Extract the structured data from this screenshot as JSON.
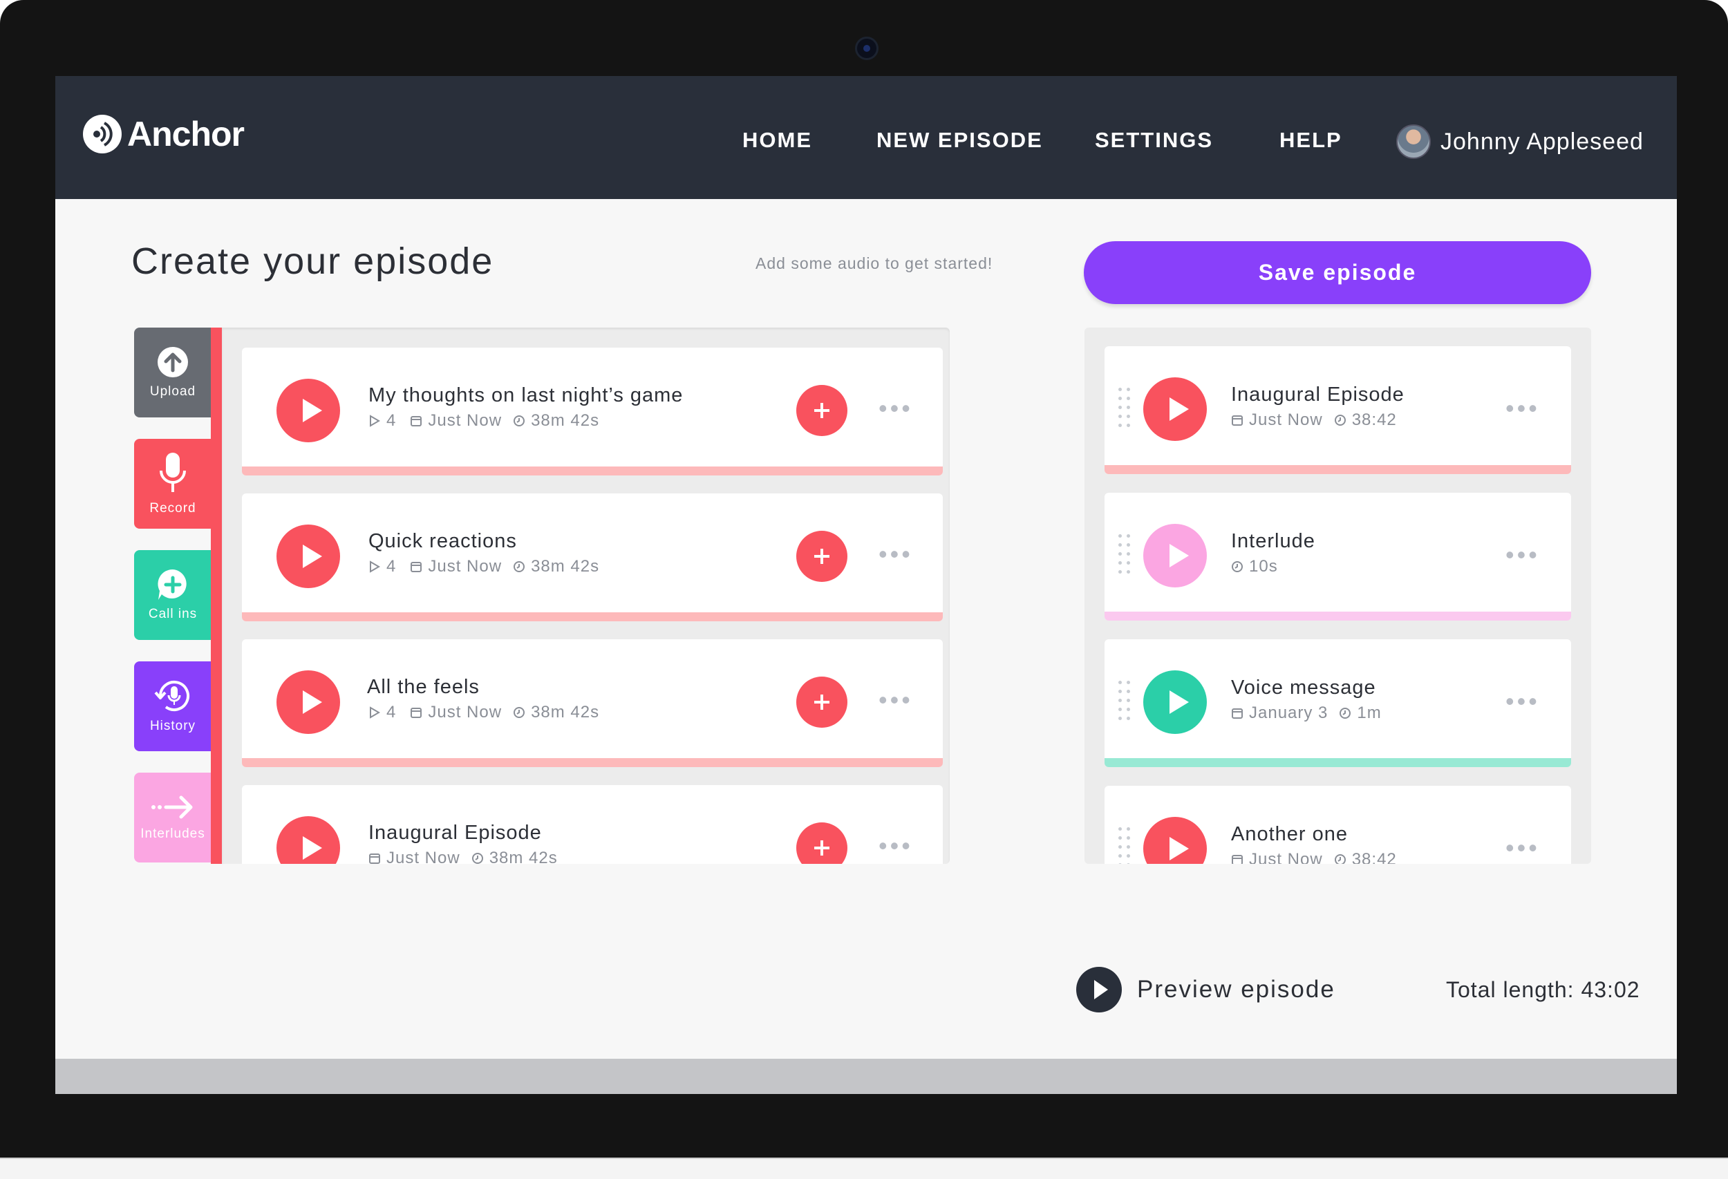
{
  "app": {
    "name": "Anchor"
  },
  "nav": {
    "items": [
      {
        "label": "HOME"
      },
      {
        "label": "NEW EPISODE"
      },
      {
        "label": "SETTINGS"
      },
      {
        "label": "HELP"
      }
    ],
    "user_name": "Johnny Appleseed"
  },
  "page": {
    "title": "Create your episode",
    "hint": "Add some audio to get started!",
    "save_label": "Save episode"
  },
  "sources": [
    {
      "label": "Upload",
      "icon": "upload-icon",
      "color": "#676b72"
    },
    {
      "label": "Record",
      "icon": "microphone-icon",
      "color": "#f9525e"
    },
    {
      "label": "Call ins",
      "icon": "call-in-icon",
      "color": "#2bcfa8"
    },
    {
      "label": "History",
      "icon": "history-icon",
      "color": "#8940fa"
    },
    {
      "label": "Interludes",
      "icon": "interlude-arrow-icon",
      "color": "#fba6e2"
    }
  ],
  "library": [
    {
      "title": "My thoughts on last night’s game",
      "plays": "4",
      "date": "Just Now",
      "duration": "38m 42s"
    },
    {
      "title": "Quick reactions",
      "plays": "4",
      "date": "Just Now",
      "duration": "38m 42s"
    },
    {
      "title": "All the feels",
      "plays": "4",
      "date": "Just Now",
      "duration": "38m 42s"
    },
    {
      "title": "Inaugural Episode",
      "plays": "",
      "date": "Just Now",
      "duration": "38m 42s"
    }
  ],
  "episode": [
    {
      "title": "Inaugural Episode",
      "date": "Just Now",
      "duration": "38:42",
      "color": "#f9525e",
      "bar_color": "#fdb9ba"
    },
    {
      "title": "Interlude",
      "date": "",
      "duration": "10s",
      "color": "#fba6e2",
      "bar_color": "#fbc9ef"
    },
    {
      "title": "Voice message",
      "date": "January 3",
      "duration": "1m",
      "color": "#2bcfa8",
      "bar_color": "#98e9d4"
    },
    {
      "title": "Another one",
      "date": "Just Now",
      "duration": "38:42",
      "color": "#f9525e",
      "bar_color": "#fdb9ba"
    }
  ],
  "footer": {
    "preview_label": "Preview episode",
    "total_length": "Total length: 43:02"
  },
  "colors": {
    "accent": "#8940fa",
    "primary_red": "#f9525e",
    "topbar": "#292f3a",
    "progress_red": "#fdb9ba"
  }
}
